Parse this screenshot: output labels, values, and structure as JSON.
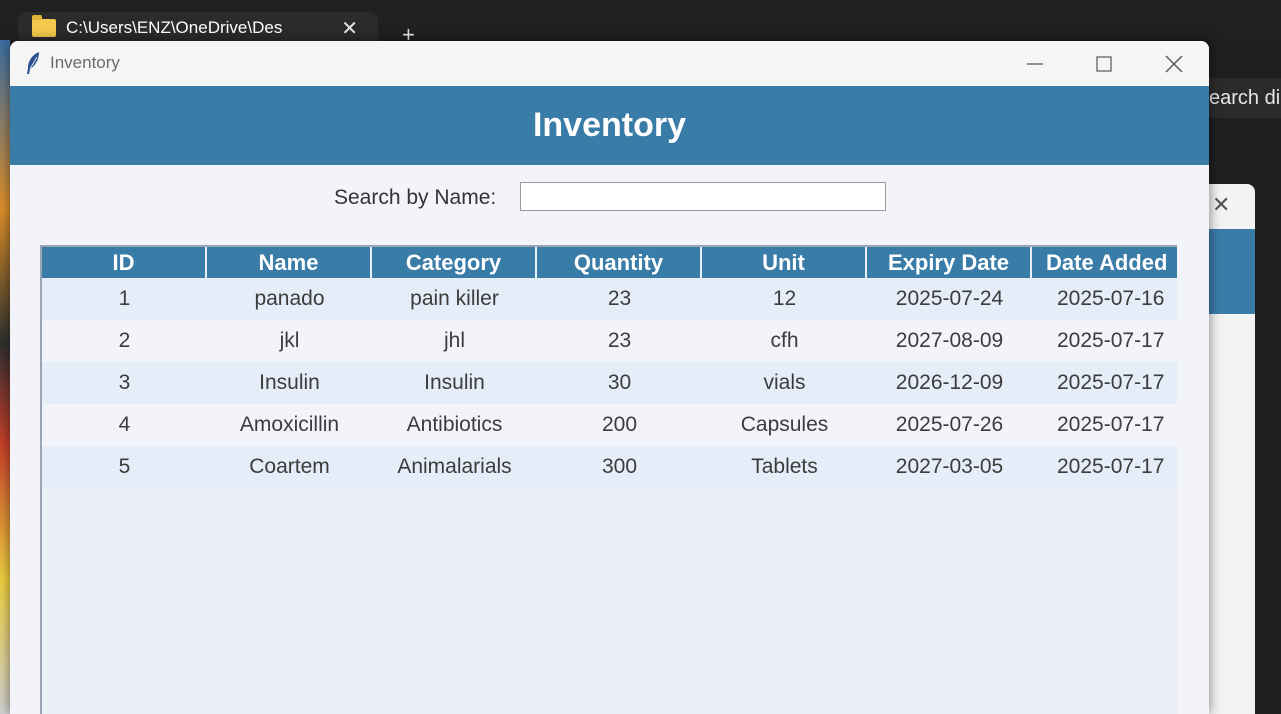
{
  "background": {
    "explorer_tab_title": "C:\\Users\\ENZ\\OneDrive\\Des",
    "tab_close_glyph": "✕",
    "new_tab_glyph": "+",
    "right_search_text": "earch di",
    "dialog_close_glyph": "✕"
  },
  "window": {
    "title": "Inventory",
    "icon": "feather-icon",
    "controls": [
      "minimize-icon",
      "maximize-icon",
      "close-icon"
    ]
  },
  "header": {
    "title": "Inventory",
    "color": "#3a7ca8"
  },
  "search": {
    "label": "Search by Name:",
    "value": "",
    "placeholder": ""
  },
  "table": {
    "columns": [
      "ID",
      "Name",
      "Category",
      "Quantity",
      "Unit",
      "Expiry Date",
      "Date Added"
    ],
    "rows": [
      [
        "1",
        "panado",
        "pain killer",
        "23",
        "12",
        "2025-07-24",
        "2025-07-16"
      ],
      [
        "2",
        "jkl",
        "jhl",
        "23",
        "cfh",
        "2027-08-09",
        "2025-07-17"
      ],
      [
        "3",
        "Insulin",
        "Insulin",
        "30",
        "vials",
        "2026-12-09",
        "2025-07-17"
      ],
      [
        "4",
        "Amoxicillin",
        "Antibiotics",
        "200",
        "Capsules",
        "2025-07-26",
        "2025-07-17"
      ],
      [
        "5",
        "Coartem",
        "Animalarials",
        "300",
        "Tablets",
        "2027-03-05",
        "2025-07-17"
      ]
    ]
  }
}
